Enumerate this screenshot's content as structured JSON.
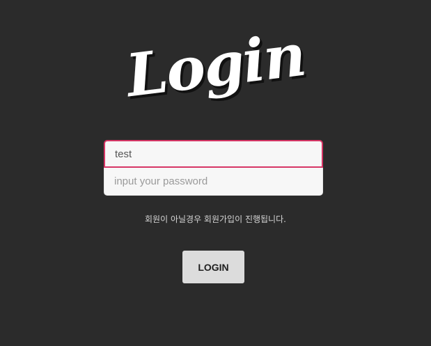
{
  "logo": {
    "text": "Login"
  },
  "form": {
    "id_value": "test",
    "password_placeholder": "input your password",
    "notice": "회원이 아닐경우 회원가입이 진행됩니다.",
    "login_label": "LOGIN"
  },
  "colors": {
    "background": "#2b2b2b",
    "focus_border": "#d63565",
    "button_bg": "#dcdcdc"
  }
}
